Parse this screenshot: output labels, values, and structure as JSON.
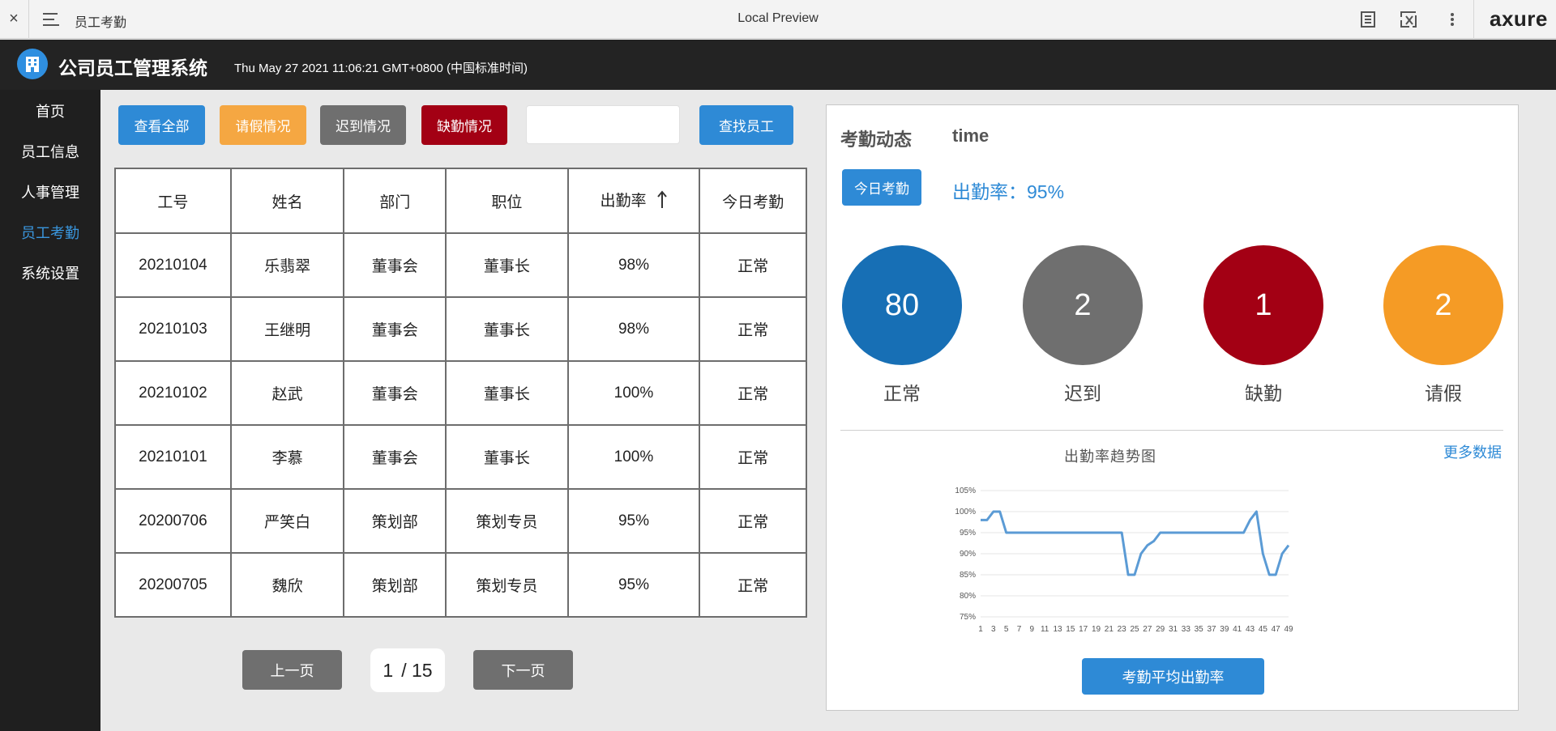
{
  "topbar": {
    "close_glyph": "×",
    "page_name": "员工考勤",
    "preview_title": "Local Preview",
    "brand": "axure"
  },
  "header": {
    "title": "公司员工管理系统",
    "datetime": "Thu May 27 2021 11:06:21 GMT+0800 (中国标准时间)"
  },
  "sidebar": {
    "items": [
      {
        "label": "首页"
      },
      {
        "label": "员工信息"
      },
      {
        "label": "人事管理"
      },
      {
        "label": "员工考勤",
        "active": true
      },
      {
        "label": "系统设置"
      }
    ]
  },
  "toolbar": {
    "view_all": "查看全部",
    "leave": "请假情况",
    "late": "迟到情况",
    "absent": "缺勤情况",
    "search_value": "",
    "search_button": "查找员工"
  },
  "colors": {
    "blue": "#2e8ad6",
    "orange": "#f5a742",
    "gray": "#6f6f6f",
    "dark_red": "#a30014",
    "circle_blue": "#176fb5",
    "circle_gray": "#6f6f6f",
    "circle_red": "#a30014",
    "circle_orange": "#f59b25"
  },
  "table": {
    "headers": [
      "工号",
      "姓名",
      "部门",
      "职位",
      "出勤率",
      "今日考勤"
    ],
    "rows": [
      [
        "20210104",
        "乐翡翠",
        "董事会",
        "董事长",
        "98%",
        "正常"
      ],
      [
        "20210103",
        "王继明",
        "董事会",
        "董事长",
        "98%",
        "正常"
      ],
      [
        "20210102",
        "赵武",
        "董事会",
        "董事长",
        "100%",
        "正常"
      ],
      [
        "20210101",
        "李慕",
        "董事会",
        "董事长",
        "100%",
        "正常"
      ],
      [
        "20200706",
        "严笑白",
        "策划部",
        "策划专员",
        "95%",
        "正常"
      ],
      [
        "20200705",
        "魏欣",
        "策划部",
        "策划专员",
        "95%",
        "正常"
      ]
    ],
    "sort_icon": "arrow-up-icon"
  },
  "pager": {
    "prev": "上一页",
    "next": "下一页",
    "current": "1",
    "total": "/ 15"
  },
  "panel": {
    "title": "考勤动态",
    "time_label": "time",
    "today_button": "今日考勤",
    "rate_text": "出勤率：95%",
    "stats": [
      {
        "value": "80",
        "label": "正常"
      },
      {
        "value": "2",
        "label": "迟到"
      },
      {
        "value": "1",
        "label": "缺勤"
      },
      {
        "value": "2",
        "label": "请假"
      }
    ],
    "more_link": "更多数据",
    "avg_button": "考勤平均出勤率"
  },
  "chart_data": {
    "type": "line",
    "title": "出勤率趋势图",
    "xlabel": "",
    "ylabel": "",
    "ylim": [
      75,
      105
    ],
    "yticks": [
      "75%",
      "80%",
      "85%",
      "90%",
      "95%",
      "100%",
      "105%"
    ],
    "x": [
      1,
      2,
      3,
      4,
      5,
      6,
      7,
      8,
      9,
      10,
      11,
      12,
      13,
      14,
      15,
      16,
      17,
      18,
      19,
      20,
      21,
      22,
      23,
      24,
      25,
      26,
      27,
      28,
      29,
      30,
      31,
      32,
      33,
      34,
      35,
      36,
      37,
      38,
      39,
      40,
      41,
      42,
      43,
      44,
      45,
      46,
      47,
      48,
      49
    ],
    "xtick_labels": [
      "1",
      "3",
      "5",
      "7",
      "9",
      "11",
      "13",
      "15",
      "17",
      "19",
      "21",
      "23",
      "25",
      "27",
      "29",
      "31",
      "33",
      "35",
      "37",
      "39",
      "41",
      "43",
      "45",
      "47",
      "49"
    ],
    "series": [
      {
        "values": [
          98,
          98,
          100,
          100,
          95,
          95,
          95,
          95,
          95,
          95,
          95,
          95,
          95,
          95,
          95,
          95,
          95,
          95,
          95,
          95,
          95,
          95,
          95,
          85,
          85,
          90,
          92,
          93,
          95,
          95,
          95,
          95,
          95,
          95,
          95,
          95,
          95,
          95,
          95,
          95,
          95,
          95,
          98,
          100,
          90,
          85,
          85,
          90,
          92
        ],
        "color": "#5b9bd5"
      }
    ],
    "grid": true,
    "legend": "none"
  }
}
